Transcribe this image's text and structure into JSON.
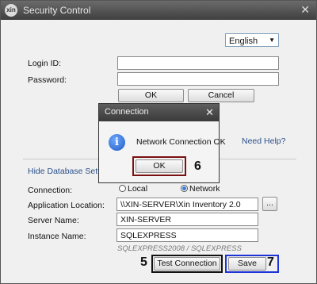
{
  "window": {
    "title": "Security Control",
    "logo_text": "xin"
  },
  "language": {
    "selected": "English"
  },
  "login": {
    "login_id_label": "Login ID:",
    "password_label": "Password:",
    "ok_label": "OK",
    "cancel_label": "Cancel",
    "need_help": "Need Help?"
  },
  "database": {
    "hide_link": "Hide Database Setting",
    "connection_label": "Connection:",
    "local_label": "Local",
    "network_label": "Network",
    "connection_selected": "Network",
    "app_location_label": "Application Location:",
    "app_location_value": "\\\\XIN-SERVER\\Xin Inventory 2.0",
    "browse_label": "...",
    "server_name_label": "Server Name:",
    "server_name_value": "XIN-SERVER",
    "instance_name_label": "Instance Name:",
    "instance_name_value": "SQLEXPRESS",
    "instance_hint": "SQLEXPRESS2008 / SQLEXPRESS",
    "test_connection_label": "Test Connection",
    "save_label": "Save"
  },
  "dialog": {
    "title": "Connection",
    "message": "Network Connection OK",
    "ok_label": "OK"
  },
  "callouts": {
    "test": "5",
    "ok": "6",
    "save": "7"
  },
  "colors": {
    "highlight_black": "#111111",
    "highlight_blue": "#1e33d6",
    "highlight_red": "#7a1010"
  }
}
